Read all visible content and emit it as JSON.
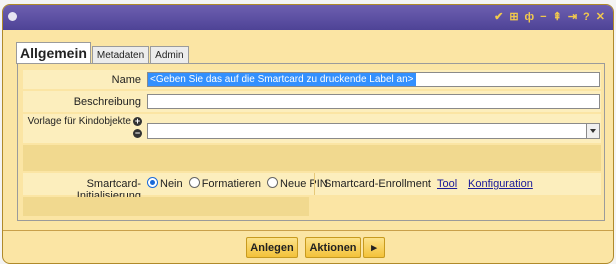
{
  "titlebar": {
    "icons": [
      "check-icon",
      "grid-icon",
      "pin-icon",
      "minus-icon",
      "arrow-up-icon",
      "arrow-right-icon",
      "help-icon",
      "close-icon"
    ]
  },
  "tabs": [
    {
      "label": "Allgemein",
      "active": true
    },
    {
      "label": "Metadaten",
      "active": false
    },
    {
      "label": "Admin",
      "active": false
    }
  ],
  "form": {
    "name_label": "Name",
    "name_value": "<Geben Sie das auf die Smartcard zu druckende Label an>",
    "beschreibung_label": "Beschreibung",
    "beschreibung_value": "",
    "vorlage_label": "Vorlage für Kindobjekte",
    "vorlage_value": "",
    "init_label": "Smartcard-Initialisierung",
    "init_options": [
      {
        "label": "Nein",
        "checked": true
      },
      {
        "label": "Formatieren",
        "checked": false
      },
      {
        "label": "Neue PIN",
        "checked": false
      }
    ],
    "enroll_label": "Smartcard-Enrollment",
    "enroll_links": [
      "Tool",
      "Konfiguration"
    ]
  },
  "footer": {
    "create_label": "Anlegen",
    "actions_label": "Aktionen",
    "actions_arrow": "▸"
  },
  "colors": {
    "accent": "#f3c23a",
    "panel": "#fbe5a4",
    "titlebar": "#5a4fa3",
    "selection": "#3390ff"
  }
}
